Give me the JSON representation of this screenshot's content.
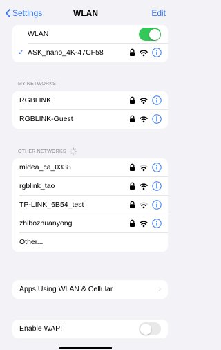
{
  "nav": {
    "back_label": "Settings",
    "title": "WLAN",
    "edit_label": "Edit"
  },
  "wlan_group": {
    "toggle_label": "WLAN",
    "toggle_on": true,
    "connected_network": "ASK_nano_4K-47CF58"
  },
  "my_networks": {
    "header": "MY NETWORKS",
    "items": [
      {
        "name": "RGBLINK"
      },
      {
        "name": "RGBLINK-Guest"
      }
    ]
  },
  "other_networks": {
    "header": "OTHER NETWORKS",
    "items": [
      {
        "name": "midea_ca_0338"
      },
      {
        "name": "rgblink_tao"
      },
      {
        "name": "TP-LINK_6B54_test"
      },
      {
        "name": "zhibozhuanyong"
      }
    ],
    "other_label": "Other..."
  },
  "apps_using": {
    "label": "Apps Using WLAN & Cellular"
  },
  "wapi": {
    "label": "Enable WAPI",
    "toggle_on": false
  },
  "colors": {
    "accent": "#3478f6",
    "toggle_on": "#34c759",
    "background": "#f2f2f7"
  }
}
